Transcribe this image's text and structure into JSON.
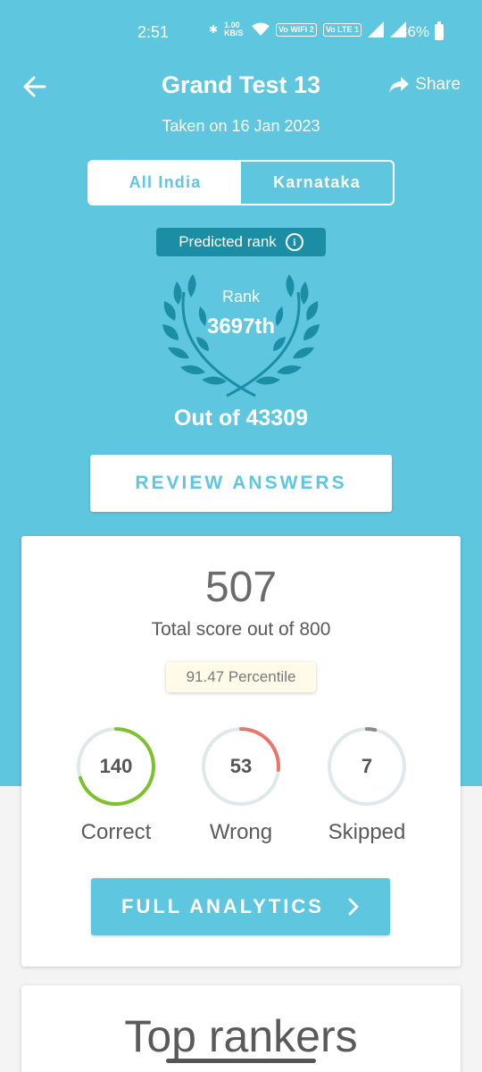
{
  "status_bar": {
    "time": "2:51",
    "net_speed": "1.00 KB/S",
    "wifi_label": "Vo WiFi 2",
    "lte_label": "Vo LTE 1",
    "battery": "86%"
  },
  "header": {
    "title": "Grand Test 13",
    "share_label": "Share",
    "taken_on": "Taken on 16 Jan 2023"
  },
  "tabs": {
    "all_india": "All India",
    "karnataka": "Karnataka",
    "selected": "Karnataka"
  },
  "rank": {
    "predicted_label": "Predicted rank",
    "rank_label": "Rank",
    "rank_value": "3697th",
    "out_of": "Out of 43309"
  },
  "review_button": "REVIEW ANSWERS",
  "score": {
    "value": "507",
    "subtitle": "Total score out of 800",
    "percentile": "91.47 Percentile"
  },
  "stats": [
    {
      "label": "Correct",
      "value": "140",
      "fraction": 0.7,
      "color": "#7cc22c"
    },
    {
      "label": "Wrong",
      "value": "53",
      "fraction": 0.265,
      "color": "#e8766b"
    },
    {
      "label": "Skipped",
      "value": "7",
      "fraction": 0.035,
      "color": "#8a8a8a"
    }
  ],
  "analytics_button": "FULL ANALYTICS",
  "top_rankers_title": "Top rankers",
  "colors": {
    "primary": "#5fc6df",
    "dark_accent": "#1b8ea6"
  }
}
